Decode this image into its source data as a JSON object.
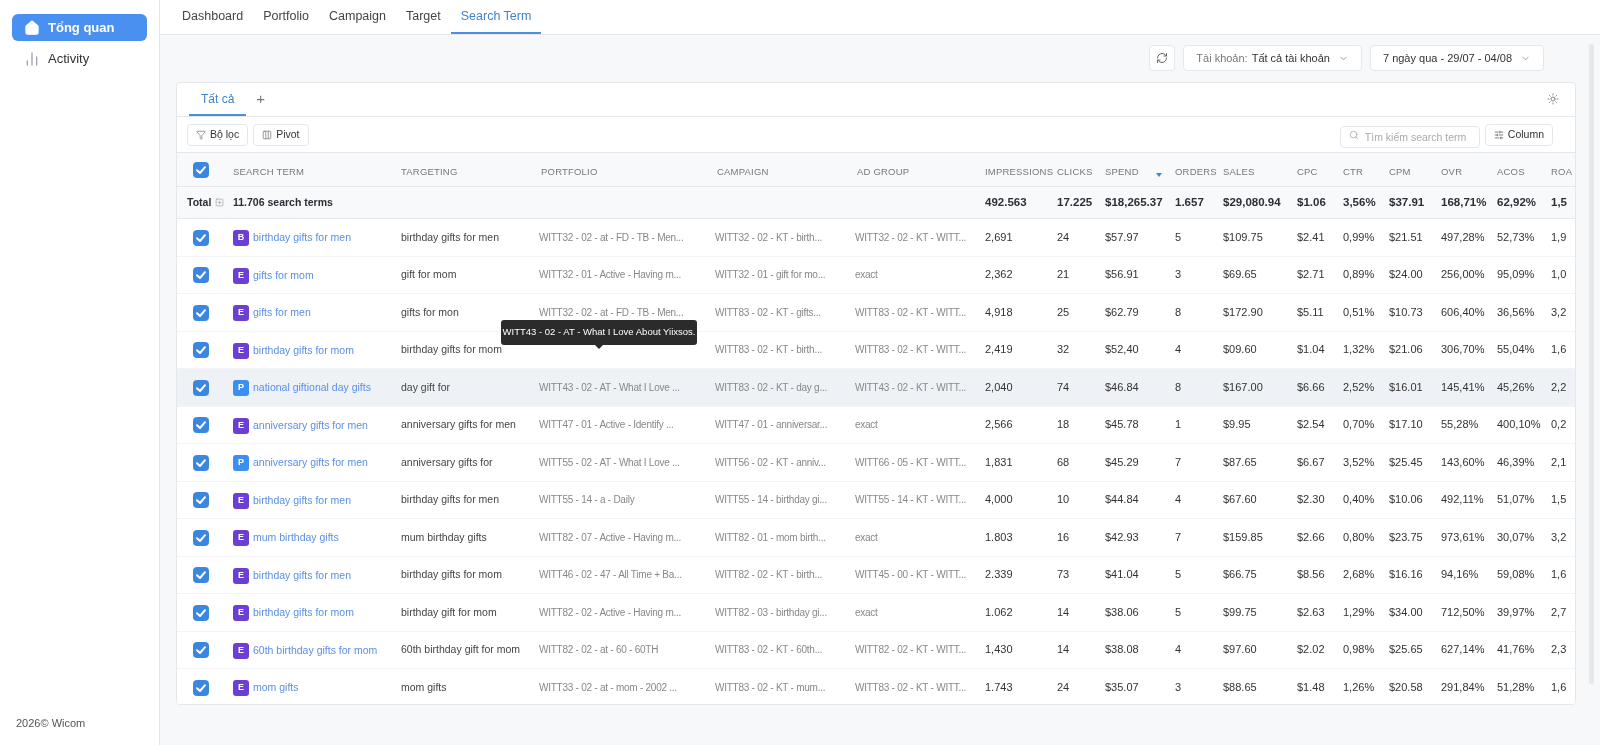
{
  "sidebar": {
    "items": [
      {
        "label": "Tổng quan",
        "kind": "home",
        "selected": true
      },
      {
        "label": "Activity",
        "kind": "chart",
        "selected": false
      }
    ],
    "footer": "2026© Wicom"
  },
  "nav_tabs": [
    {
      "label": "Dashboard",
      "selected": false
    },
    {
      "label": "Portfolio",
      "selected": false
    },
    {
      "label": "Campaign",
      "selected": false
    },
    {
      "label": "Target",
      "selected": false
    },
    {
      "label": "Search Term",
      "selected": true
    }
  ],
  "toolbar": {
    "account_label": "Tài khoản:",
    "account_value": "Tất cả tài khoản",
    "date_range": "7 ngày qua - 29/07 - 04/08"
  },
  "view_tabs": [
    {
      "label": "Tất cả",
      "selected": true
    }
  ],
  "add_tab": "+",
  "filter_button": "Bộ lọc",
  "pivot_button": "Pivot",
  "search": {
    "placeholder": "Tìm kiếm search term"
  },
  "column_button": "Column",
  "table": {
    "select_all": true,
    "columns": [
      {
        "label": "SEARCH TERM",
        "sorted": false
      },
      {
        "label": "TARGETING",
        "sorted": false
      },
      {
        "label": "PORTFOLIO",
        "sorted": false
      },
      {
        "label": "CAMPAIGN",
        "sorted": false
      },
      {
        "label": "AD GROUP",
        "sorted": false
      },
      {
        "label": "IMPRESSIONS",
        "sorted": false
      },
      {
        "label": "CLICKS",
        "sorted": false
      },
      {
        "label": "SPEND",
        "sorted": true
      },
      {
        "label": "ORDERS",
        "sorted": false
      },
      {
        "label": "SALES",
        "sorted": false
      },
      {
        "label": "CPC",
        "sorted": false
      },
      {
        "label": "CTR",
        "sorted": false
      },
      {
        "label": "CPM",
        "sorted": false
      },
      {
        "label": "OVR",
        "sorted": false
      },
      {
        "label": "ACOS",
        "sorted": false
      },
      {
        "label": "ROA",
        "sorted": false
      }
    ],
    "total": {
      "label": "Total",
      "count": "11.706 search terms",
      "metrics": [
        "492.563",
        "17.225",
        "$18,265.37",
        "1.657",
        "$29,080.94",
        "$1.06",
        "3,56%",
        "$37.91",
        "168,71%",
        "62,92%",
        "1,5"
      ]
    },
    "rows": [
      {
        "selected": true,
        "highlighted": false,
        "badge": "B",
        "color": "#6b3fd4",
        "search_term": "birthday gifts for men",
        "targeting": "birthday gifts for men",
        "portfolio": "WITT32 - 02 - at - FD - TB - Men...",
        "campaign": "WITT32 - 02 - KT - birth...",
        "ad_group": "WITT32 - 02 - KT - WITT...",
        "metrics": [
          "2,691",
          "24",
          "$57.97",
          "5",
          "$109.75",
          "$2.41",
          "0,99%",
          "$21.51",
          "497,28%",
          "52,73%",
          "1,9"
        ]
      },
      {
        "selected": true,
        "highlighted": false,
        "badge": "E",
        "color": "#6b3fd4",
        "search_term": "gifts for mom",
        "targeting": "gift for mom",
        "portfolio": "WITT32 - 01 - Active - Having m...",
        "campaign": "WITT32 - 01 - gift for mo...",
        "ad_group": "exact",
        "metrics": [
          "2,362",
          "21",
          "$56.91",
          "3",
          "$69.65",
          "$2.71",
          "0,89%",
          "$24.00",
          "256,00%",
          "95,09%",
          "1,0"
        ]
      },
      {
        "selected": true,
        "highlighted": false,
        "badge": "E",
        "color": "#6b3fd4",
        "search_term": "gifts for men",
        "targeting": "gifts for mon",
        "portfolio": "WITT32 - 02 - at - FD - TB - Men...",
        "campaign": "WITT83 - 02 - KT - gifts...",
        "ad_group": "WITT83 - 02 - KT - WITT...",
        "metrics": [
          "4,918",
          "25",
          "$62.79",
          "8",
          "$172.90",
          "$5.11",
          "0,51%",
          "$10.73",
          "606,40%",
          "36,56%",
          "3,2"
        ]
      },
      {
        "selected": true,
        "highlighted": false,
        "badge": "E",
        "color": "#6b3fd4",
        "search_term": "birthday gifts for mom",
        "targeting": "birthday gifts for mom",
        "tooltip": "WITT43 - 02 - AT - What I Love About Yiixsos.",
        "campaign": "WITT83 - 02 - KT - birth...",
        "ad_group": "WITT83 - 02 - KT - WITT...",
        "metrics": [
          "2,419",
          "32",
          "$52,40",
          "4",
          "$09.60",
          "$1.04",
          "1,32%",
          "$21.06",
          "306,70%",
          "55,04%",
          "1,6"
        ]
      },
      {
        "selected": true,
        "highlighted": true,
        "badge": "P",
        "color": "#3b8ff0",
        "search_term": "national giftional day gifts",
        "targeting": "day gift for",
        "portfolio": "WITT43 - 02 - AT - What I Love ...",
        "campaign": "WITT83 - 02 - KT - day g...",
        "ad_group": "WITT43 - 02 - KT - WITT...",
        "metrics": [
          "2,040",
          "74",
          "$46.84",
          "8",
          "$167.00",
          "$6.66",
          "2,52%",
          "$16.01",
          "145,41%",
          "45,26%",
          "2,2"
        ]
      },
      {
        "selected": true,
        "highlighted": false,
        "badge": "E",
        "color": "#6b3fd4",
        "search_term": "anniversary gifts for men",
        "targeting": "anniversary gifts for men",
        "portfolio": "WITT47 - 01 - Active - Identify ...",
        "campaign": "WITT47 - 01 - anniversar...",
        "ad_group": "exact",
        "metrics": [
          "2,566",
          "18",
          "$45.78",
          "1",
          "$9.95",
          "$2.54",
          "0,70%",
          "$17.10",
          "55,28%",
          "400,10%",
          "0,2"
        ]
      },
      {
        "selected": true,
        "highlighted": false,
        "badge": "P",
        "color": "#3b8ff0",
        "search_term": "anniversary gifts for men",
        "targeting": "anniversary gifts for",
        "portfolio": "WITT55 - 02 - AT - What I Love ...",
        "campaign": "WITT56 - 02 - KT - anniv...",
        "ad_group": "WITT66 - 05 - KT - WITT...",
        "metrics": [
          "1,831",
          "68",
          "$45.29",
          "7",
          "$87.65",
          "$6.67",
          "3,52%",
          "$25.45",
          "143,60%",
          "46,39%",
          "2,1"
        ]
      },
      {
        "selected": true,
        "highlighted": false,
        "badge": "E",
        "color": "#6b3fd4",
        "search_term": "birthday gifts for men",
        "targeting": "birthday gifts for men",
        "portfolio": "WITT55 - 14 - a - Daily",
        "campaign": "WITT55 - 14 - birthday gi...",
        "ad_group": "WITT55 - 14 - KT - WITT...",
        "metrics": [
          "4,000",
          "10",
          "$44.84",
          "4",
          "$67.60",
          "$2.30",
          "0,40%",
          "$10.06",
          "492,11%",
          "51,07%",
          "1,5"
        ]
      },
      {
        "selected": true,
        "highlighted": false,
        "badge": "E",
        "color": "#6b3fd4",
        "search_term": "mum birthday gifts",
        "targeting": "mum birthday gifts",
        "portfolio": "WITT82 - 07 - Active - Having m...",
        "campaign": "WITT82 - 01 - mom birth...",
        "ad_group": "exact",
        "metrics": [
          "1.803",
          "16",
          "$42.93",
          "7",
          "$159.85",
          "$2.66",
          "0,80%",
          "$23.75",
          "973,61%",
          "30,07%",
          "3,2"
        ]
      },
      {
        "selected": true,
        "highlighted": false,
        "badge": "E",
        "color": "#6b3fd4",
        "search_term": "birthday gifts for men",
        "targeting": "birthday gifts for mom",
        "portfolio": "WITT46 - 02 - 47 - All Time + Ba...",
        "campaign": "WITT82 - 02 - KT - birth...",
        "ad_group": "WITT45 - 00 - KT - WITT...",
        "metrics": [
          "2.339",
          "73",
          "$41.04",
          "5",
          "$66.75",
          "$8.56",
          "2,68%",
          "$16.16",
          "94,16%",
          "59,08%",
          "1,6"
        ]
      },
      {
        "selected": true,
        "highlighted": false,
        "badge": "E",
        "color": "#6b3fd4",
        "search_term": "birthday gifts for mom",
        "targeting": "birthday gift for mom",
        "portfolio": "WITT82 - 02 - Active - Having m...",
        "campaign": "WITT82 - 03 - birthday gi...",
        "ad_group": "exact",
        "metrics": [
          "1.062",
          "14",
          "$38.06",
          "5",
          "$99.75",
          "$2.63",
          "1,29%",
          "$34.00",
          "712,50%",
          "39,97%",
          "2,7"
        ]
      },
      {
        "selected": true,
        "highlighted": false,
        "badge": "E",
        "color": "#6b3fd4",
        "search_term": "60th birthday gifts for mom",
        "targeting": "60th birthday gift for mom",
        "portfolio": "WITT82 - 02 - at - 60 - 60TH",
        "campaign": "WITT83 - 02 - KT - 60th...",
        "ad_group": "WITT82 - 02 - KT - WITT...",
        "metrics": [
          "1,430",
          "14",
          "$38.08",
          "4",
          "$97.60",
          "$2.02",
          "0,98%",
          "$25.65",
          "627,14%",
          "41,76%",
          "2,3"
        ]
      },
      {
        "selected": true,
        "highlighted": false,
        "badge": "E",
        "color": "#6b3fd4",
        "search_term": "mom gifts",
        "targeting": "mom gifts",
        "portfolio": "WITT33 - 02 - at - mom - 2002 ...",
        "campaign": "WITT83 - 02 - KT - mum...",
        "ad_group": "WITT83 - 02 - KT - WITT...",
        "metrics": [
          "1.743",
          "24",
          "$35.07",
          "3",
          "$88.65",
          "$1.48",
          "1,26%",
          "$20.58",
          "291,84%",
          "51,28%",
          "1,6"
        ]
      }
    ]
  }
}
